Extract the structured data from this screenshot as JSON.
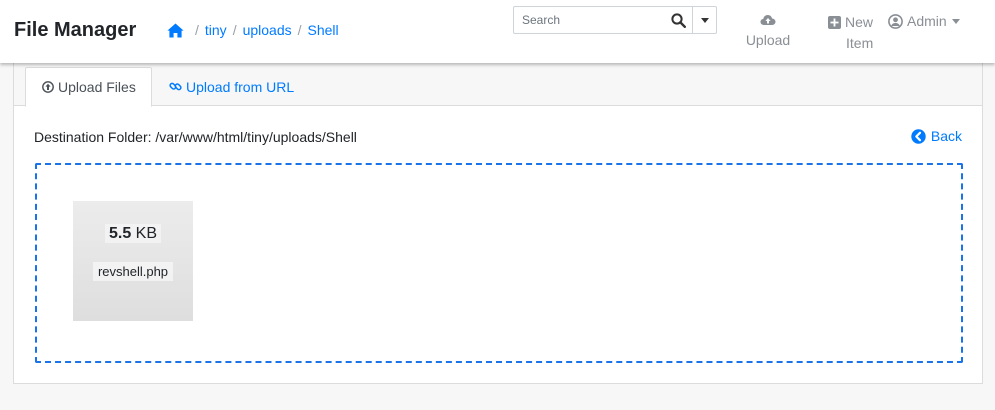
{
  "app": {
    "title": "File Manager"
  },
  "breadcrumb": {
    "items": [
      "tiny",
      "uploads",
      "Shell"
    ],
    "separator": "/"
  },
  "search": {
    "placeholder": "Search",
    "value": ""
  },
  "nav": {
    "upload_label": "Upload",
    "new_item_line1": "New",
    "new_item_line2": "Item",
    "user_label": "Admin"
  },
  "tabs": [
    {
      "label": "Upload Files",
      "active": true
    },
    {
      "label": "Upload from URL",
      "active": false
    }
  ],
  "upload": {
    "destination_label": "Destination Folder: /var/www/html/tiny/uploads/Shell",
    "back_label": "Back",
    "file": {
      "size_value": "5.5",
      "size_unit": "KB",
      "name": "revshell.php"
    }
  },
  "colors": {
    "link": "#007bff",
    "dropzone_border": "#1a73e8",
    "muted_nav": "#8a8f95"
  },
  "icons": {
    "home": "home-icon",
    "search": "search-icon",
    "upload": "cloud-upload-icon",
    "new_item": "plus-square-icon",
    "user": "user-circle-icon",
    "upload_files_tab": "arrow-circle-up-icon",
    "upload_url_tab": "link-icon",
    "back": "chevron-circle-left-icon"
  }
}
